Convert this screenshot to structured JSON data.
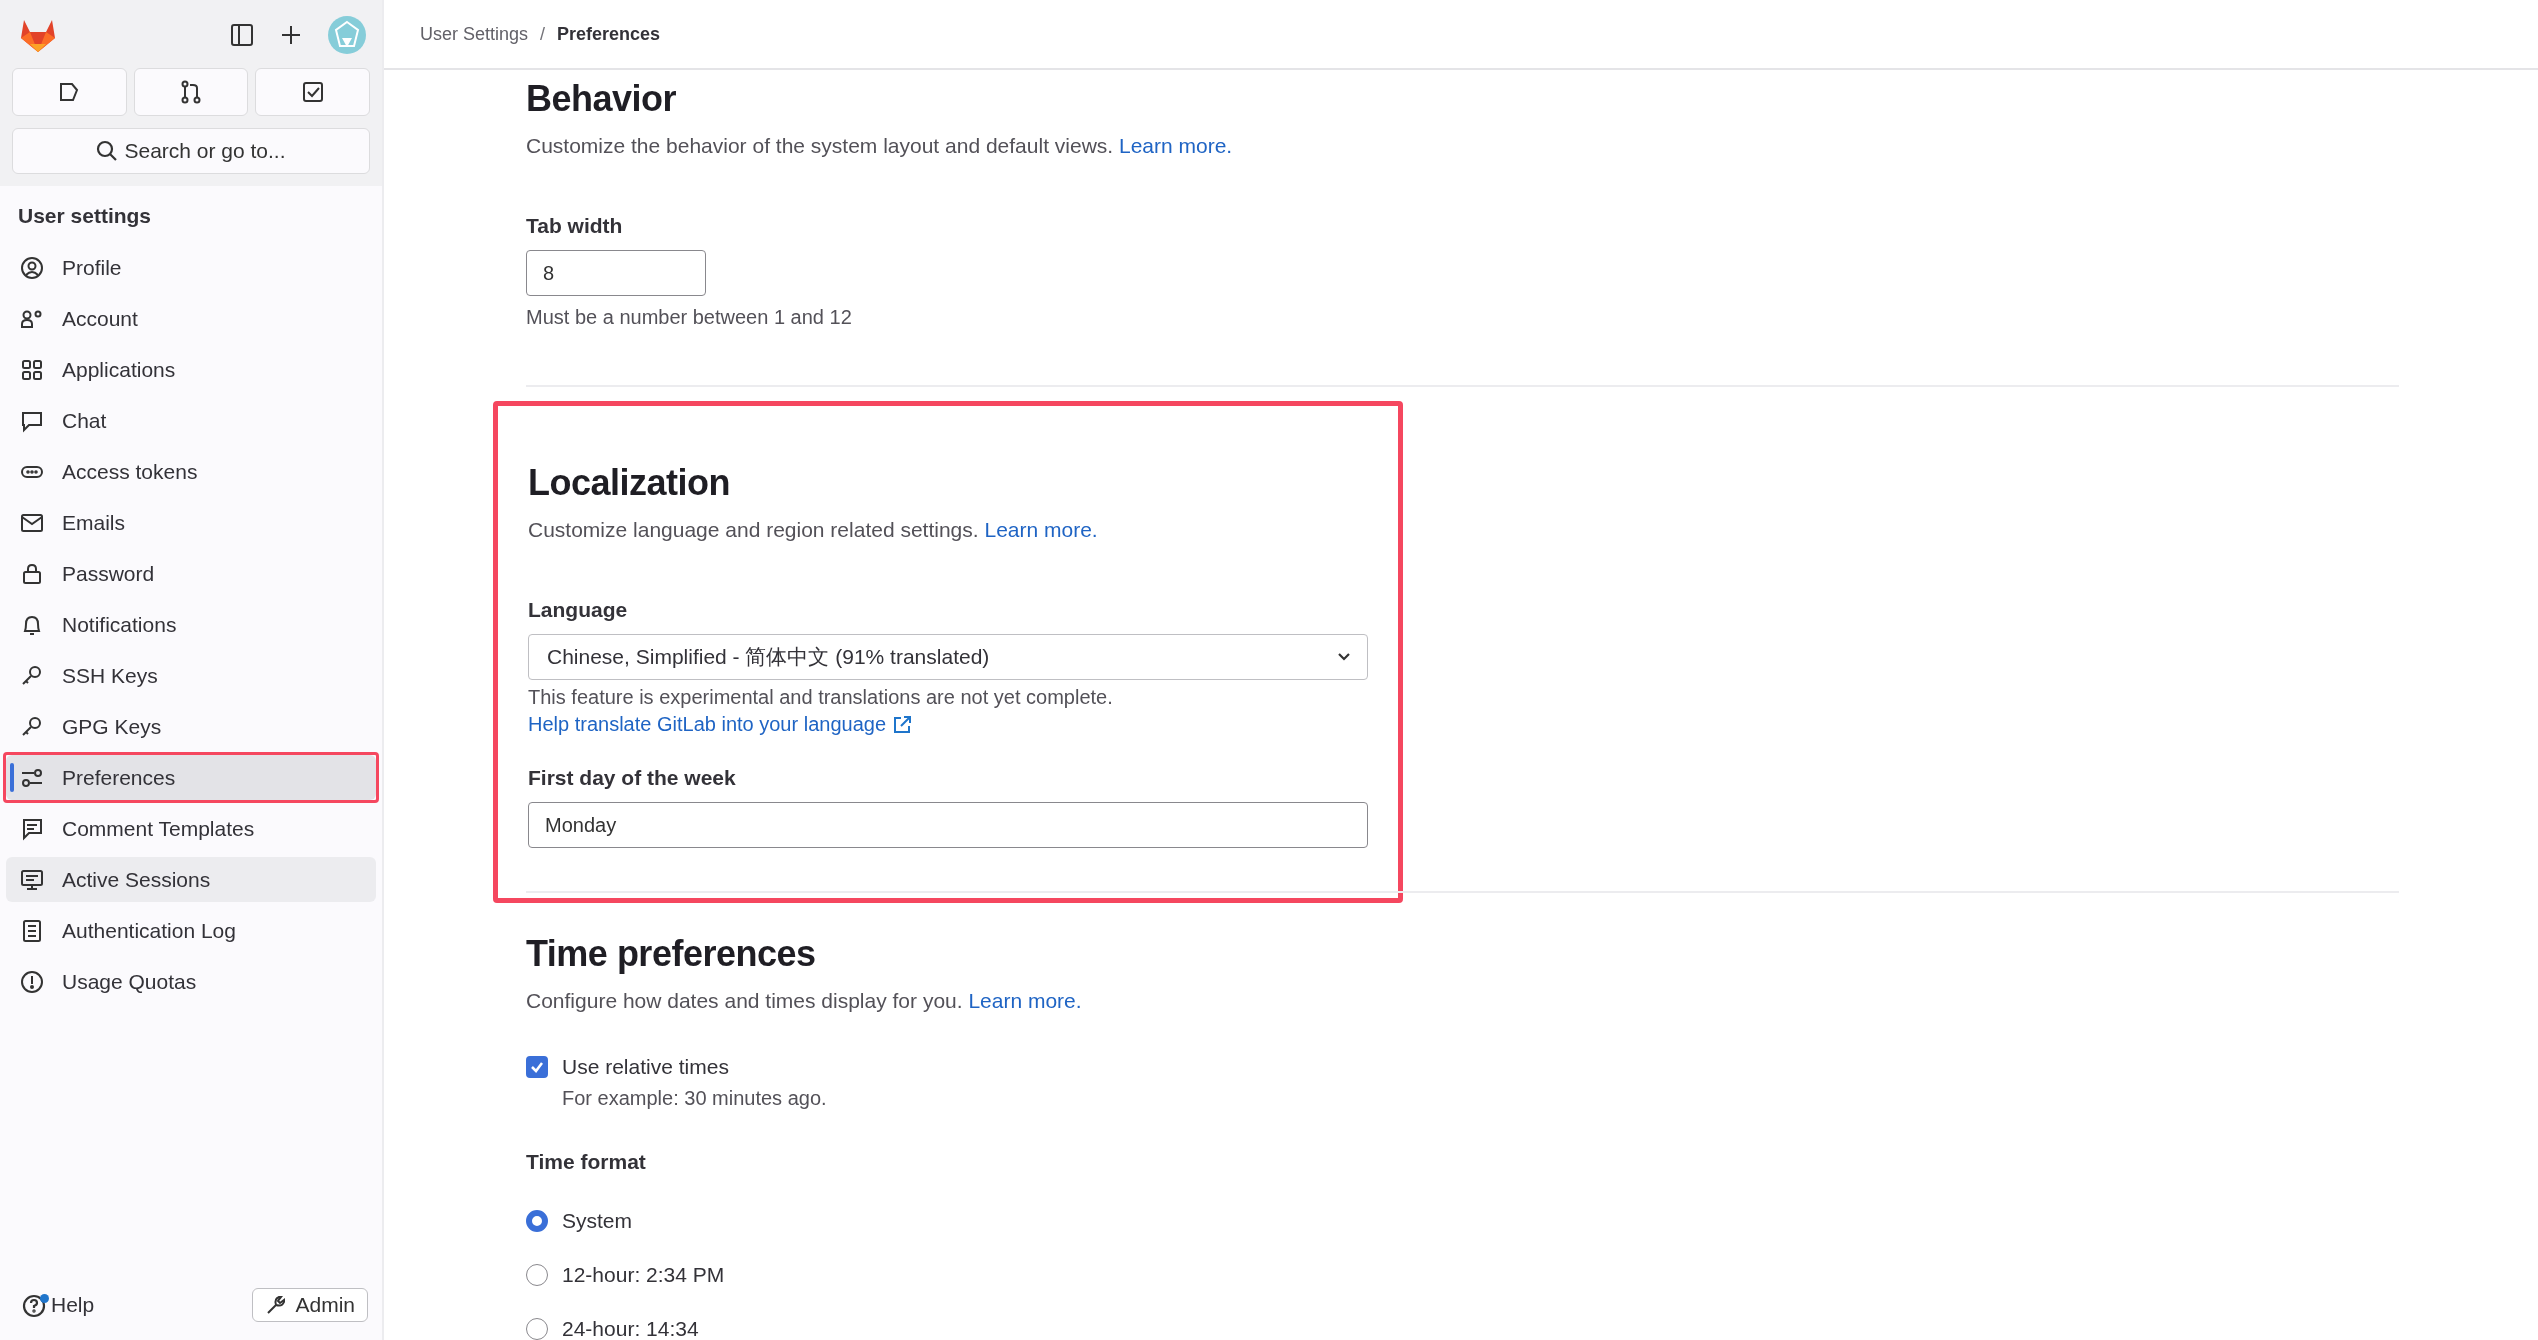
{
  "sidebar": {
    "search": {
      "placeholder": "Search or go to..."
    },
    "heading": "User settings",
    "items": [
      {
        "label": "Profile",
        "selected": false,
        "hovered": false,
        "annotated": false
      },
      {
        "label": "Account",
        "selected": false,
        "hovered": false,
        "annotated": false
      },
      {
        "label": "Applications",
        "selected": false,
        "hovered": false,
        "annotated": false
      },
      {
        "label": "Chat",
        "selected": false,
        "hovered": false,
        "annotated": false
      },
      {
        "label": "Access tokens",
        "selected": false,
        "hovered": false,
        "annotated": false
      },
      {
        "label": "Emails",
        "selected": false,
        "hovered": false,
        "annotated": false
      },
      {
        "label": "Password",
        "selected": false,
        "hovered": false,
        "annotated": false
      },
      {
        "label": "Notifications",
        "selected": false,
        "hovered": false,
        "annotated": false
      },
      {
        "label": "SSH Keys",
        "selected": false,
        "hovered": false,
        "annotated": false
      },
      {
        "label": "GPG Keys",
        "selected": false,
        "hovered": false,
        "annotated": false
      },
      {
        "label": "Preferences",
        "selected": true,
        "hovered": false,
        "annotated": true
      },
      {
        "label": "Comment Templates",
        "selected": false,
        "hovered": false,
        "annotated": false
      },
      {
        "label": "Active Sessions",
        "selected": false,
        "hovered": true,
        "annotated": false
      },
      {
        "label": "Authentication Log",
        "selected": false,
        "hovered": false,
        "annotated": false
      },
      {
        "label": "Usage Quotas",
        "selected": false,
        "hovered": false,
        "annotated": false
      }
    ],
    "help": {
      "label": "Help",
      "notification": true
    },
    "admin": "Admin"
  },
  "breadcrumb": {
    "items": [
      "User Settings",
      "Preferences"
    ],
    "separator": "/"
  },
  "behavior": {
    "title": "Behavior",
    "description": "Customize the behavior of the system layout and default views.",
    "link": "Learn more.",
    "tab_width": {
      "label": "Tab width",
      "value": "8",
      "hint": "Must be a number between 1 and 12"
    }
  },
  "localization": {
    "annotated": true,
    "title": "Localization",
    "description": "Customize language and region related settings.",
    "link": "Learn more.",
    "language": {
      "label": "Language",
      "value": "Chinese, Simplified - 简体中文 (91% translated)",
      "note": "This feature is experimental and translations are not yet complete.",
      "help_link": "Help translate GitLab into your language"
    },
    "first_day": {
      "label": "First day of the week",
      "value": "Monday"
    }
  },
  "time_preferences": {
    "title": "Time preferences",
    "description": "Configure how dates and times display for you.",
    "link": "Learn more.",
    "relative": {
      "label": "Use relative times",
      "checked": true,
      "hint": "For example: 30 minutes ago."
    },
    "format_label": "Time format",
    "formats": [
      {
        "label": "System",
        "selected": true
      },
      {
        "label": "12-hour: 2:34 PM",
        "selected": false
      },
      {
        "label": "24-hour: 14:34",
        "selected": false
      }
    ]
  }
}
